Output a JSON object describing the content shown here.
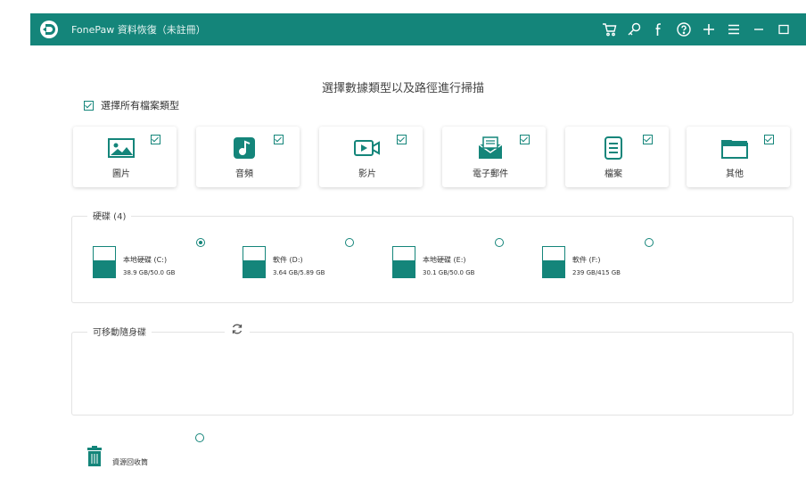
{
  "app": {
    "title": "FonePaw 資料恢復（未註冊）",
    "icons": [
      "cart-icon",
      "key-icon",
      "facebook-icon",
      "help-icon",
      "plus-icon",
      "menu-icon",
      "minimize-icon",
      "maximize-icon"
    ]
  },
  "heading": "選擇數據類型以及路徑進行掃描",
  "select_all": {
    "label": "選擇所有檔案類型",
    "checked": true
  },
  "file_types": [
    {
      "label": "圖片",
      "icon": "image-icon",
      "checked": true
    },
    {
      "label": "音頻",
      "icon": "music-icon",
      "checked": true
    },
    {
      "label": "影片",
      "icon": "video-icon",
      "checked": true
    },
    {
      "label": "電子郵件",
      "icon": "email-icon",
      "checked": true
    },
    {
      "label": "檔案",
      "icon": "document-icon",
      "checked": true
    },
    {
      "label": "其他",
      "icon": "folder-icon",
      "checked": true
    }
  ],
  "hard_drives": {
    "label": "硬碟 (4)",
    "drives": [
      {
        "name": "本地硬碟 (C:)",
        "size": "38.9 GB/50.0 GB",
        "selected": true
      },
      {
        "name": "軟件 (D:)",
        "size": "3.64 GB/5.89 GB",
        "selected": false
      },
      {
        "name": "本地硬碟 (E:)",
        "size": "30.1 GB/50.0 GB",
        "selected": false
      },
      {
        "name": "軟件 (F:)",
        "size": "239 GB/415 GB",
        "selected": false
      }
    ]
  },
  "removable": {
    "label": "可移動隨身碟"
  },
  "recycle_bin": {
    "label": "資源回收筒",
    "selected": false
  },
  "colors": {
    "accent": "#14857a",
    "titlebar": "#14857a"
  }
}
